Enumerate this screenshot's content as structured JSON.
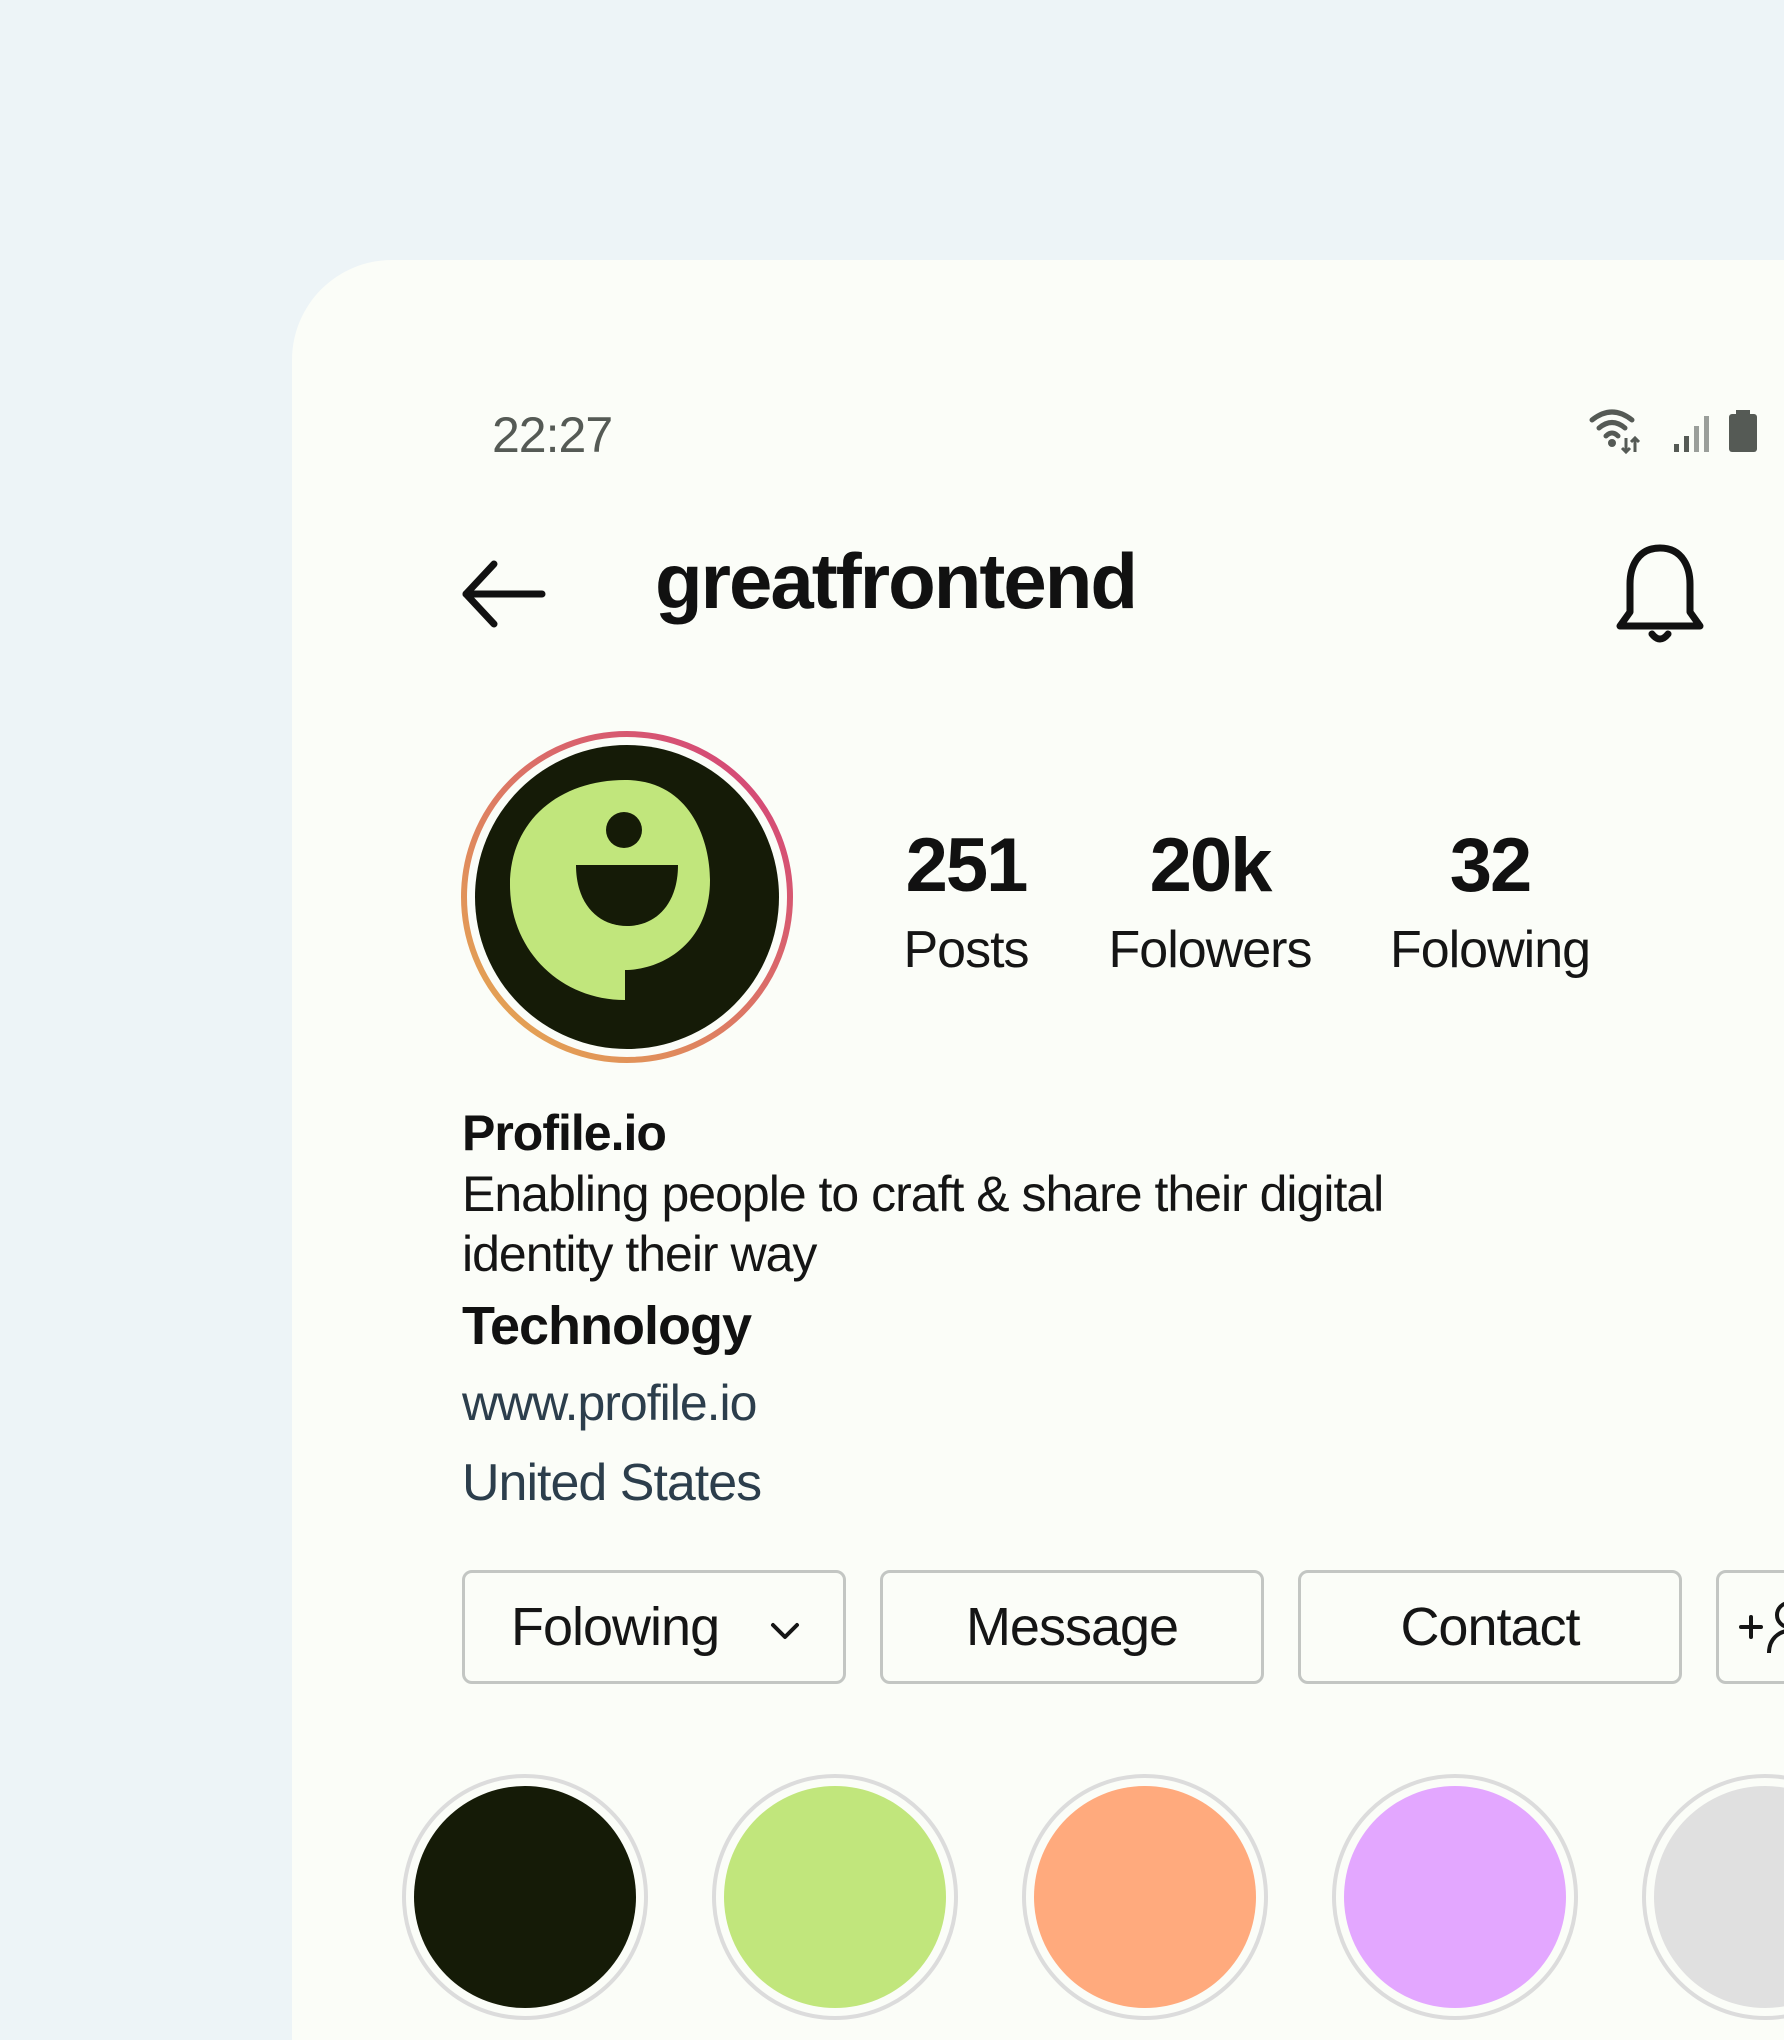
{
  "status_bar": {
    "time": "22:27",
    "icons": [
      "wifi-icon",
      "signal-icon",
      "battery-icon"
    ]
  },
  "header": {
    "title": "greatfrontend",
    "back_icon": "arrow-left-icon",
    "notification_icon": "bell-icon"
  },
  "profile": {
    "avatar_colors": {
      "background": "#151b07",
      "mark": "#c1e67c",
      "ring_start": "#e6b04e",
      "ring_end": "#d23b7c"
    },
    "stats": [
      {
        "value": "251",
        "label": "Posts"
      },
      {
        "value": "20k",
        "label": "Folowers"
      },
      {
        "value": "32",
        "label": "Folowing"
      }
    ],
    "name": "Profile.io",
    "description_line1": "Enabling people to craft & share their digital",
    "description_line2": "identity their way",
    "category": "Technology",
    "website": "www.profile.io",
    "location": "United States"
  },
  "actions": {
    "following_label": "Folowing",
    "message_label": "Message",
    "contact_label": "Contact",
    "add_user_icon": "add-user-icon"
  },
  "highlights": [
    {
      "color": "#151b07"
    },
    {
      "color": "#c1e67c"
    },
    {
      "color": "#ffaa7d"
    },
    {
      "color": "#e3a7ff"
    },
    {
      "color": "#e0e0e0"
    }
  ]
}
